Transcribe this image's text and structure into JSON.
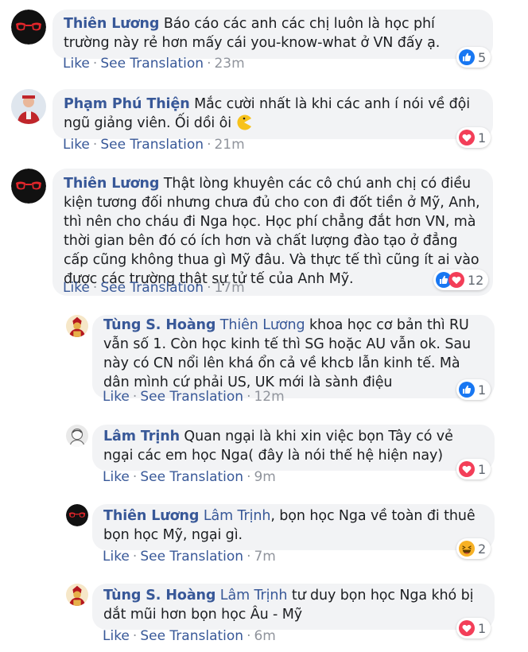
{
  "comments": [
    {
      "author": "Thiên Lương",
      "text": "Báo cáo các anh các chị luôn là học phí trường này rẻ hơn mấy cái you-know-what ở VN đấy ạ.",
      "like_label": "Like",
      "translate_label": "See Translation",
      "time": "23m",
      "reaction_count": "5",
      "reactions": [
        "like"
      ]
    },
    {
      "author": "Phạm Phú Thiện",
      "text": "Mắc cười nhất là khi các anh í nói về đội ngũ giảng viên. Ối dồi ôi",
      "emoji": "pacman",
      "like_label": "Like",
      "translate_label": "See Translation",
      "time": "21m",
      "reaction_count": "1",
      "reactions": [
        "love"
      ]
    },
    {
      "author": "Thiên Lương",
      "text": "Thật lòng khuyên các cô chú anh chị có điều kiện tương đối nhưng chưa đủ cho con đi đốt tiền ở Mỹ, Anh, thì nên cho cháu đi Nga học. Học phí chẳng đắt hơn VN, mà thời gian bên đó có ích hơn và chất lượng đào tạo ở đẳng cấp cũng không thua gì Mỹ đâu. Và thực tế thì cũng ít ai vào được các trường thật sự tử tế của Anh Mỹ.",
      "like_label": "Like",
      "translate_label": "See Translation",
      "time": "17m",
      "reaction_count": "12",
      "reactions": [
        "like",
        "love"
      ]
    }
  ],
  "replies": [
    {
      "author": "Tùng S. Hoàng",
      "mention": "Thiên Lương",
      "text": "khoa học cơ bản thì RU vẫn số 1. Còn học kinh tế thì SG hoặc AU vẫn ok. Sau này có CN nổi lên khá ổn cả về khcb lẫn kinh tế. Mà dân mình cứ phải US, UK mới là sành điệu",
      "like_label": "Like",
      "translate_label": "See Translation",
      "time": "12m",
      "reaction_count": "1",
      "reactions": [
        "like"
      ]
    },
    {
      "author": "Lâm Trịnh",
      "mention": "",
      "text": "Quan ngại là khi xin việc bọn Tây có vẻ ngại các em học Nga( đây là nói thế hệ hiện nay)",
      "like_label": "Like",
      "translate_label": "See Translation",
      "time": "9m",
      "reaction_count": "1",
      "reactions": [
        "love"
      ]
    },
    {
      "author": "Thiên Lương",
      "mention": "Lâm Trịnh",
      "text": ", bọn học Nga về toàn đi thuê bọn học Mỹ, ngại gì.",
      "like_label": "Like",
      "translate_label": "See Translation",
      "time": "7m",
      "reaction_count": "2",
      "reactions": [
        "haha"
      ]
    },
    {
      "author": "Tùng S. Hoàng",
      "mention": "Lâm Trịnh",
      "text": "tư duy bọn học Nga khó bị dắt mũi hơn bọn học Âu - Mỹ",
      "like_label": "Like",
      "translate_label": "See Translation",
      "time": "6m",
      "reaction_count": "1",
      "reactions": [
        "love"
      ]
    }
  ],
  "colors": {
    "link": "#385898",
    "muted": "#90949c",
    "bubble": "#f2f3f5",
    "like_blue": "#1877f2",
    "love_red": "#f33e58",
    "haha_yellow": "#f7b125"
  }
}
